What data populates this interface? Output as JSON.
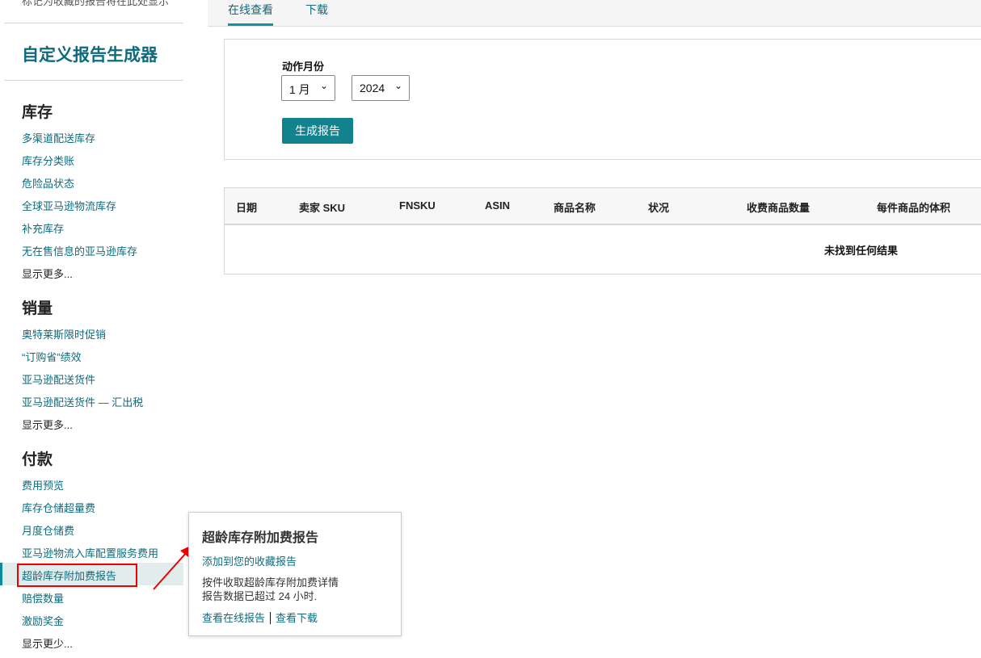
{
  "sidebar": {
    "top_note": "标记为收藏的报告将在此处显示",
    "title": "自定义报告生成器",
    "sections": [
      {
        "heading": "库存",
        "items": [
          "多渠道配送库存",
          "库存分类账",
          "危险品状态",
          "全球亚马逊物流库存",
          "补充库存",
          "无在售信息的亚马逊库存"
        ],
        "more": "显示更多..."
      },
      {
        "heading": "销量",
        "items": [
          "奥特莱斯限时促销",
          "“订购省”绩效",
          "亚马逊配送货件",
          "亚马逊配送货件 — 汇出税"
        ],
        "more": "显示更多..."
      },
      {
        "heading": "付款",
        "items": [
          "费用预览",
          "库存仓储超量费",
          "月度仓储费",
          "亚马逊物流入库配置服务费用",
          "超龄库存附加费报告",
          "赔偿数量",
          "激励奖金"
        ],
        "more": "显示更少..."
      }
    ]
  },
  "tabs": [
    "在线查看",
    "下载"
  ],
  "form": {
    "label": "动作月份",
    "month": "1 月",
    "year": "2024",
    "generate": "生成报告"
  },
  "table": {
    "columns": [
      "日期",
      "卖家 SKU",
      "FNSKU",
      "ASIN",
      "商品名称",
      "状况",
      "收费商品数量",
      "每件商品的体积"
    ],
    "empty": "未找到任何结果"
  },
  "popover": {
    "title": "超龄库存附加费报告",
    "favorite": "添加到您的收藏报告",
    "desc1": "按件收取超龄库存附加费详情",
    "desc2": "报告数据已超过 24 小时.",
    "view_online": "查看在线报告",
    "view_download": "查看下载"
  },
  "colors": {
    "accent": "#0e6b7e",
    "button": "#12828f",
    "highlight": "#e00000"
  }
}
